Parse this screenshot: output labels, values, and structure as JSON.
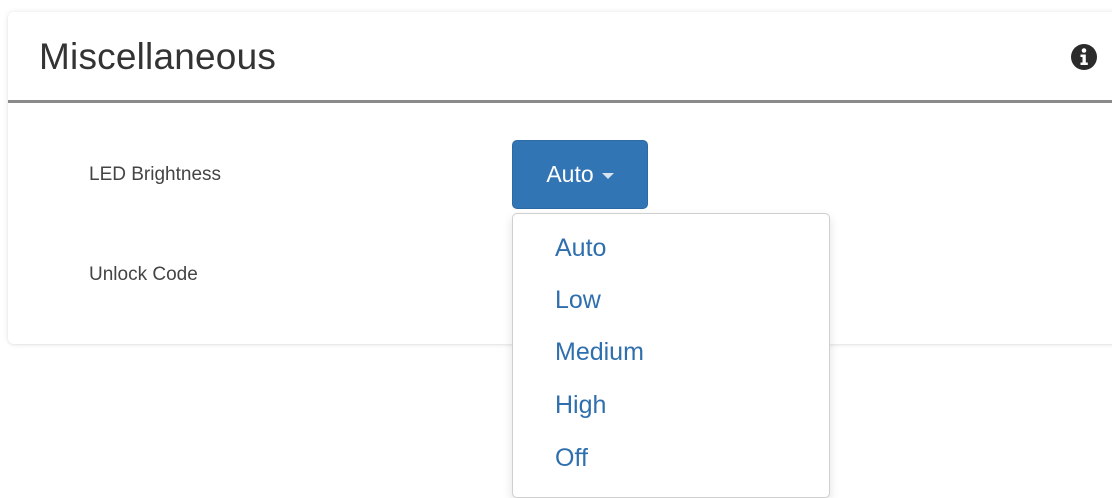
{
  "panel": {
    "title": "Miscellaneous",
    "info_icon": "info-circle-icon"
  },
  "fields": {
    "led_brightness_label": "LED Brightness",
    "unlock_code_label": "Unlock Code"
  },
  "dropdown": {
    "selected": "Auto",
    "caret_icon": "caret-down-icon",
    "options": [
      "Auto",
      "Low",
      "Medium",
      "High",
      "Off"
    ]
  },
  "colors": {
    "button_bg": "#3275b4",
    "link": "#2f6fad",
    "header_rule": "#8a8a8a"
  }
}
